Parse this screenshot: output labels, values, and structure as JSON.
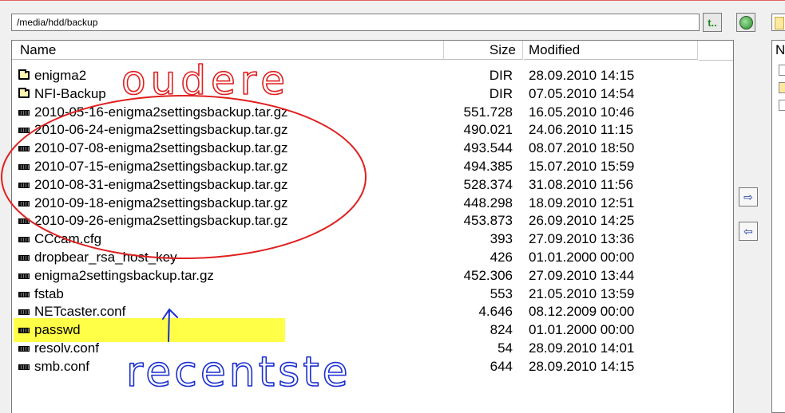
{
  "path": "/media/hdd/backup",
  "toolbar": {
    "updir_label": "t..",
    "refresh_label": "↻"
  },
  "columns": {
    "name": "Name",
    "size": "Size",
    "modified": "Modified"
  },
  "right_panel": {
    "header": "N"
  },
  "files": [
    {
      "type": "folder",
      "name": "enigma2",
      "size": "DIR",
      "modified": "28.09.2010 14:15"
    },
    {
      "type": "folder",
      "name": "NFI-Backup",
      "size": "DIR",
      "modified": "07.05.2010 14:54"
    },
    {
      "type": "file",
      "name": "2010-05-16-enigma2settingsbackup.tar.gz",
      "size": "551.728",
      "modified": "16.05.2010 10:46"
    },
    {
      "type": "file",
      "name": "2010-06-24-enigma2settingsbackup.tar.gz",
      "size": "490.021",
      "modified": "24.06.2010 11:15"
    },
    {
      "type": "file",
      "name": "2010-07-08-enigma2settingsbackup.tar.gz",
      "size": "493.544",
      "modified": "08.07.2010 18:50"
    },
    {
      "type": "file",
      "name": "2010-07-15-enigma2settingsbackup.tar.gz",
      "size": "494.385",
      "modified": "15.07.2010 15:59"
    },
    {
      "type": "file",
      "name": "2010-08-31-enigma2settingsbackup.tar.gz",
      "size": "528.374",
      "modified": "31.08.2010 11:56"
    },
    {
      "type": "file",
      "name": "2010-09-18-enigma2settingsbackup.tar.gz",
      "size": "448.298",
      "modified": "18.09.2010 12:51"
    },
    {
      "type": "file",
      "name": "2010-09-26-enigma2settingsbackup.tar.gz",
      "size": "453.873",
      "modified": "26.09.2010 14:25"
    },
    {
      "type": "file",
      "name": "CCcam.cfg",
      "size": "393",
      "modified": "27.09.2010 13:36"
    },
    {
      "type": "file",
      "name": "dropbear_rsa_host_key",
      "size": "426",
      "modified": "01.01.2000 00:00"
    },
    {
      "type": "file",
      "name": "enigma2settingsbackup.tar.gz",
      "size": "452.306",
      "modified": "27.09.2010 13:44"
    },
    {
      "type": "file",
      "name": "fstab",
      "size": "553",
      "modified": "21.05.2010 13:59"
    },
    {
      "type": "file",
      "name": "NETcaster.conf",
      "size": "4.646",
      "modified": "08.12.2009 00:00"
    },
    {
      "type": "file",
      "name": "passwd",
      "size": "824",
      "modified": "01.01.2000 00:00"
    },
    {
      "type": "file",
      "name": "resolv.conf",
      "size": "54",
      "modified": "28.09.2010 14:01"
    },
    {
      "type": "file",
      "name": "smb.conf",
      "size": "644",
      "modified": "28.09.2010 14:15"
    }
  ],
  "annotations": {
    "older_label": "oudere",
    "recent_label": "recentste",
    "older_color": "#e02020",
    "recent_color": "#1a2fd0",
    "highlight_color": "#ffff33"
  }
}
